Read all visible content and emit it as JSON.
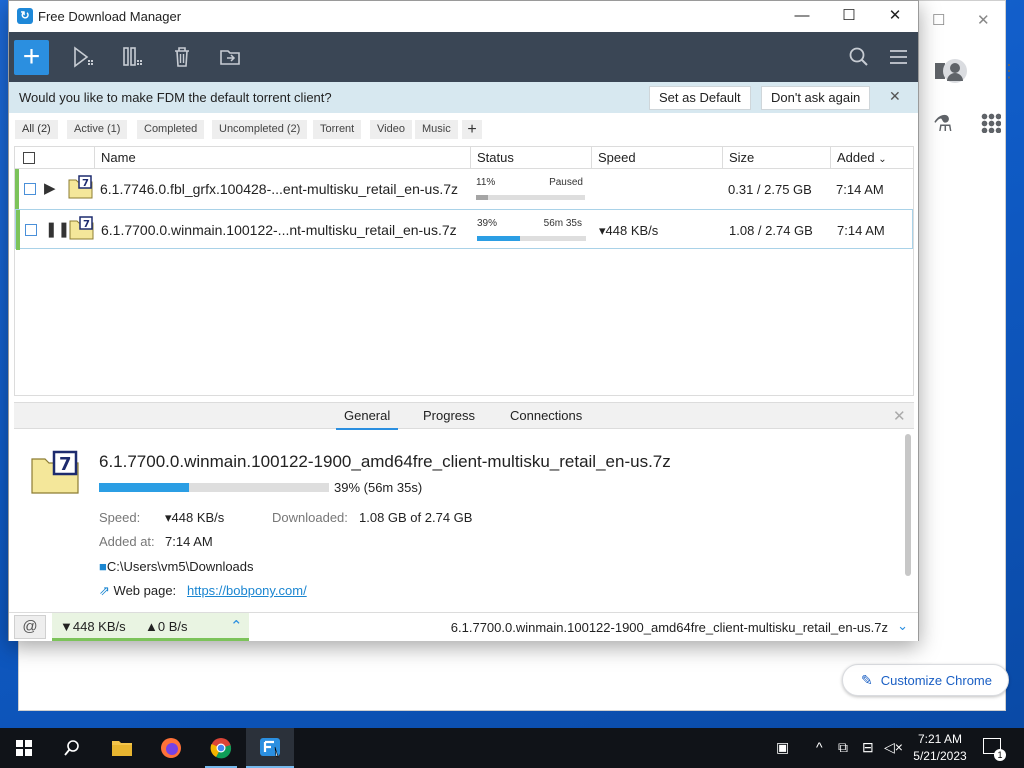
{
  "window": {
    "title": "Free Download Manager",
    "controls": {
      "minimize": "—",
      "maximize": "☐",
      "close": "✕"
    }
  },
  "toolbar": {
    "add_label": "+",
    "buttons": [
      "add-download",
      "resume-all",
      "pause-all",
      "delete",
      "move-to"
    ],
    "accent_color": "#2b8fe0"
  },
  "banner": {
    "text": "Would you like to make FDM the default torrent client?",
    "set_default": "Set as Default",
    "dont_ask": "Don't ask again",
    "close": "✕"
  },
  "filters": {
    "tabs": [
      "All (2)",
      "Active (1)",
      "Completed",
      "Uncompleted (2)",
      "Torrent",
      "Video",
      "Music"
    ],
    "add": "+"
  },
  "table": {
    "columns": [
      "Name",
      "Status",
      "Speed",
      "Size",
      "Added"
    ],
    "rows": [
      {
        "name": "6.1.7746.0.fbl_grfx.100428-...ent-multisku_retail_en-us.7z",
        "percent_label": "11%",
        "status": "Paused",
        "progress": 0.11,
        "speed": "",
        "size": "0.31 / 2.75 GB",
        "added": "7:14 AM",
        "control": "▶"
      },
      {
        "name": "6.1.7700.0.winmain.100122-...nt-multisku_retail_en-us.7z",
        "percent_label": "39%",
        "status": "56m 35s",
        "progress": 0.39,
        "speed": "▾448 KB/s",
        "size": "1.08 / 2.74 GB",
        "added": "7:14 AM",
        "control": "❚❚"
      }
    ]
  },
  "details": {
    "tabs": [
      "General",
      "Progress",
      "Connections"
    ],
    "filename": "6.1.7700.0.winmain.100122-1900_amd64fre_client-multisku_retail_en-us.7z",
    "progress": 0.39,
    "progress_text": "39% (56m 35s)",
    "speed_label": "Speed:",
    "speed_value": "▾448 KB/s",
    "downloaded_label": "Downloaded:",
    "downloaded_value": "1.08 GB of 2.74 GB",
    "added_label": "Added at:",
    "added_value": "7:14 AM",
    "path": "C:\\Users\\vm5\\Downloads",
    "webpage_label": "Web page:",
    "webpage_url": "https://bobpony.com/"
  },
  "statusbar": {
    "down": "▼448 KB/s",
    "up": "▲0 B/s",
    "current_file": "6.1.7700.0.winmain.100122-1900_amd64fre_client-multisku_retail_en-us.7z"
  },
  "chrome": {
    "customize_label": "Customize Chrome"
  },
  "taskbar": {
    "time": "7:21 AM",
    "date": "5/21/2023",
    "notification_count": "1"
  }
}
